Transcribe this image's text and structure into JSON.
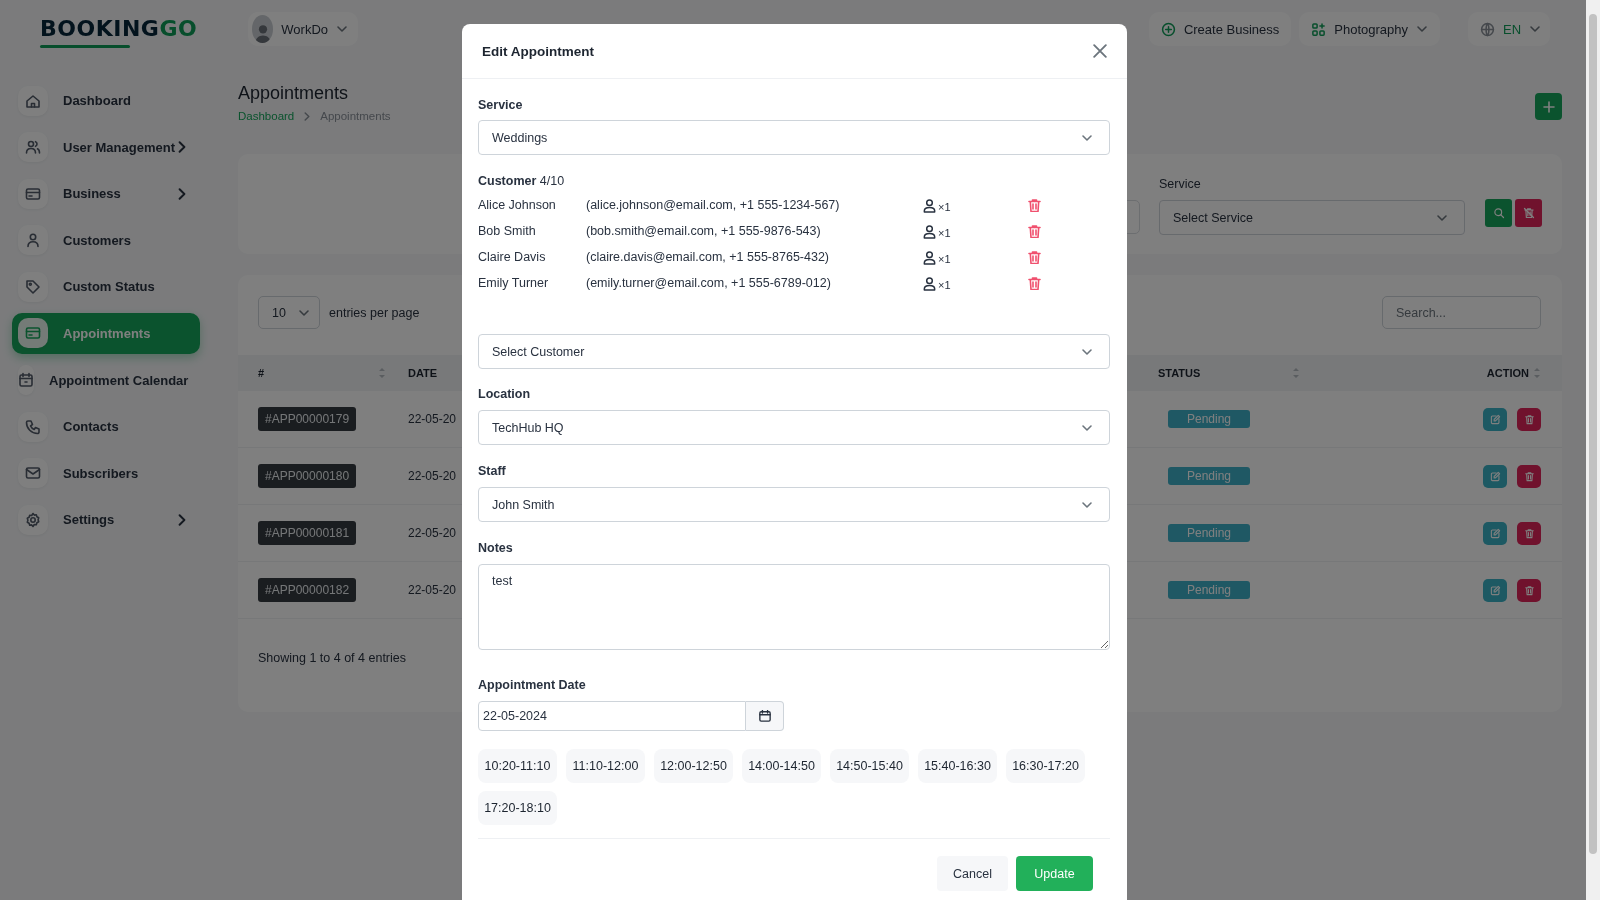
{
  "sidebar": {
    "logo": {
      "main": "BOOKING",
      "accent": "GO"
    },
    "items": [
      {
        "label": "Dashboard",
        "selected": false,
        "has_submenu": false
      },
      {
        "label": "User Management",
        "selected": false,
        "has_submenu": true
      },
      {
        "label": "Business",
        "selected": false,
        "has_submenu": true
      },
      {
        "label": "Customers",
        "selected": false,
        "has_submenu": false
      },
      {
        "label": "Custom Status",
        "selected": false,
        "has_submenu": false
      },
      {
        "label": "Appointments",
        "selected": true,
        "has_submenu": false
      },
      {
        "label": "Appointment Calendar",
        "selected": false,
        "has_submenu": false
      },
      {
        "label": "Contacts",
        "selected": false,
        "has_submenu": false
      },
      {
        "label": "Subscribers",
        "selected": false,
        "has_submenu": false
      },
      {
        "label": "Settings",
        "selected": false,
        "has_submenu": true
      }
    ]
  },
  "header": {
    "workspace": "WorkDo",
    "create_business": "Create Business",
    "business": "Photography",
    "language": "EN"
  },
  "page": {
    "title": "Appointments",
    "breadcrumb": [
      "Dashboard",
      "Appointments"
    ]
  },
  "filter": {
    "service_label": "Service",
    "service_value": "Select Service"
  },
  "table": {
    "page_size": "10",
    "entries_label": "entries per page",
    "search": {
      "placeholder": "Search..."
    },
    "columns": [
      "#",
      "DATE",
      "STATUS",
      "ACTION"
    ],
    "rows": [
      {
        "id": "#APP00000179",
        "date": "22-05-20",
        "status": "Pending"
      },
      {
        "id": "#APP00000180",
        "date": "22-05-20",
        "status": "Pending"
      },
      {
        "id": "#APP00000181",
        "date": "22-05-20",
        "status": "Pending"
      },
      {
        "id": "#APP00000182",
        "date": "22-05-20",
        "status": "Pending"
      }
    ],
    "footer": "Showing 1 to 4 of 4 entries"
  },
  "modal": {
    "title": "Edit Appointment",
    "service": {
      "label": "Service",
      "value": "Weddings"
    },
    "customers": {
      "label": "Customer",
      "count": "4/10",
      "select_value": "Select Customer",
      "items": [
        {
          "name": "Alice Johnson",
          "details": "(alice.johnson@email.com, +1 555-1234-567)",
          "quantity": "×1"
        },
        {
          "name": "Bob Smith",
          "details": "(bob.smith@email.com, +1 555-9876-543)",
          "quantity": "×1"
        },
        {
          "name": "Claire Davis",
          "details": "(claire.davis@email.com, +1 555-8765-432)",
          "quantity": "×1"
        },
        {
          "name": "Emily Turner",
          "details": "(emily.turner@email.com, +1 555-6789-012)",
          "quantity": "×1"
        }
      ]
    },
    "location": {
      "label": "Location",
      "value": "TechHub HQ"
    },
    "staff": {
      "label": "Staff",
      "value": "John Smith"
    },
    "notes": {
      "label": "Notes",
      "value": "test"
    },
    "date": {
      "label": "Appointment Date",
      "value": "22-05-2024"
    },
    "slots": [
      {
        "label": "10:20-11:10",
        "selected": false
      },
      {
        "label": "11:10-12:00",
        "selected": false
      },
      {
        "label": "12:00-12:50",
        "selected": false
      },
      {
        "label": "14:00-14:50",
        "selected": false
      },
      {
        "label": "14:50-15:40",
        "selected": false
      },
      {
        "label": "15:40-16:30",
        "selected": false
      },
      {
        "label": "16:30-17:20",
        "selected": false
      },
      {
        "label": "17:20-18:10",
        "selected": false
      }
    ],
    "buttons": {
      "cancel": "Cancel",
      "update": "Update"
    }
  }
}
